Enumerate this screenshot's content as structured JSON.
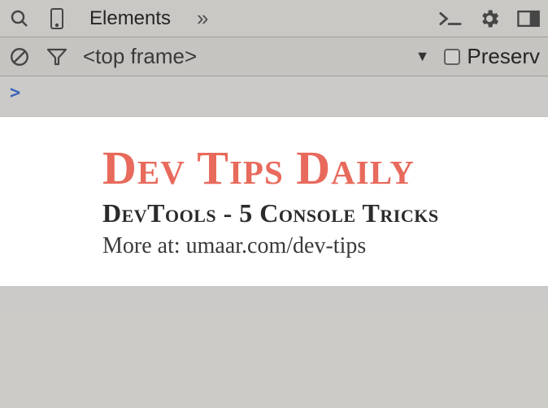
{
  "toolbar": {
    "tab_label": "Elements",
    "overflow_glyph": "»"
  },
  "console_bar": {
    "frame_label": "<top frame>",
    "preserve_label": "Preserv"
  },
  "console": {
    "prompt": ">"
  },
  "banner": {
    "title": "Dev Tips Daily",
    "subtitle": "DevTools - 5 Console Tricks",
    "more": "More at: umaar.com/dev-tips"
  }
}
